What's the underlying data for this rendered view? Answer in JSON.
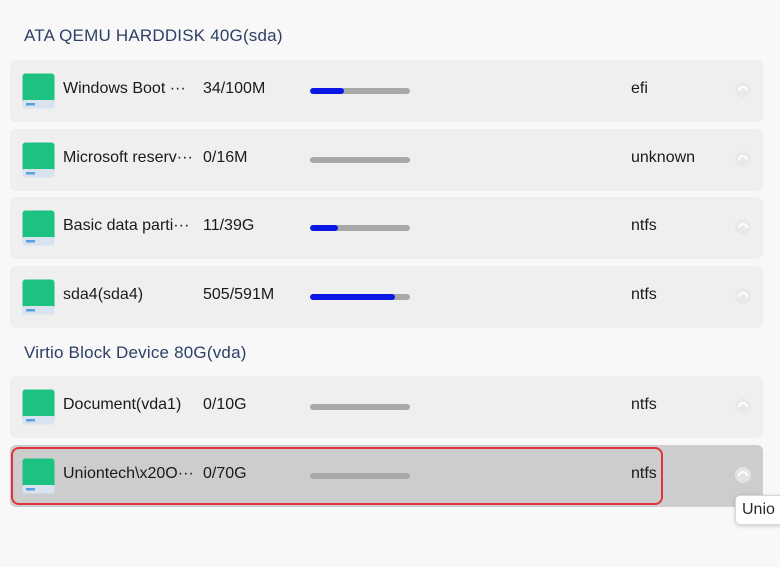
{
  "groups": [
    {
      "title": "ATA QEMU HARDDISK 40G(sda)",
      "partitions": [
        {
          "name": "Windows Boot ···",
          "usage": "34/100M",
          "fill": 0.34,
          "fs": "efi"
        },
        {
          "name": "Microsoft reserv···",
          "usage": "0/16M",
          "fill": 0.0,
          "fs": "unknown"
        },
        {
          "name": "Basic data parti···",
          "usage": "11/39G",
          "fill": 0.28,
          "fs": "ntfs"
        },
        {
          "name": "sda4(sda4)",
          "usage": "505/591M",
          "fill": 0.85,
          "fs": "ntfs"
        }
      ]
    },
    {
      "title": "Virtio Block Device 80G(vda)",
      "partitions": [
        {
          "name": "Document(vda1)",
          "usage": "0/10G",
          "fill": 0.0,
          "fs": "ntfs"
        },
        {
          "name": "Uniontech\\x20O···",
          "usage": "0/70G",
          "fill": 0.0,
          "fs": "ntfs",
          "selected": true
        }
      ]
    }
  ],
  "tooltip": "Unio",
  "icons": {
    "disk": "disk-drive-icon",
    "mount": "mount-icon"
  },
  "colors": {
    "header_text": "#2d3f66",
    "bar_fill": "#0a17e6",
    "bar_track": "#a9a9a9",
    "selection_border": "#e2333d",
    "disk_icon": "#1dc181"
  }
}
